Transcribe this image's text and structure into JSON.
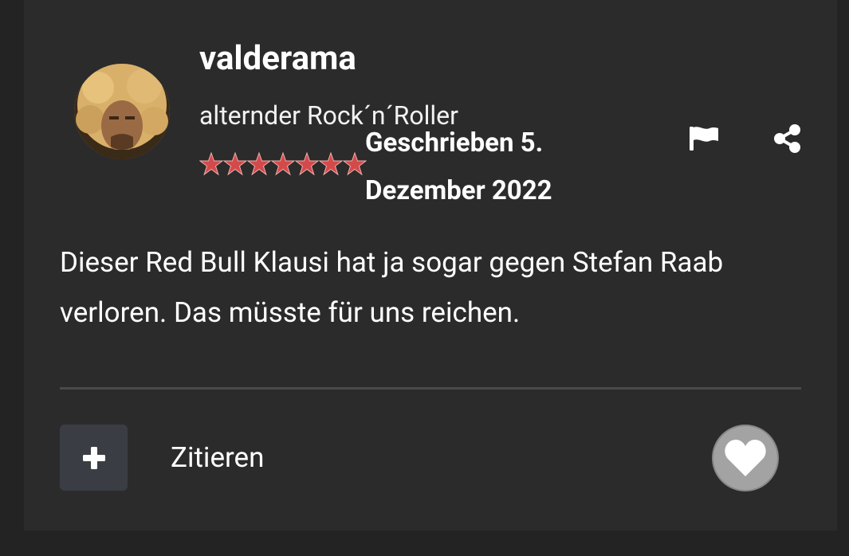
{
  "post": {
    "author": {
      "username": "valderama",
      "user_title": "alternder Rock´n´Roller",
      "rank_stars": 7,
      "avatar_icon": "avatar-photo"
    },
    "date": "Geschrieben 5. Dezember 2022",
    "body": "Dieser Red Bull Klausi hat ja sogar gegen Stefan Raab verloren. Das müsste für uns reichen.",
    "actions": {
      "multiquote_icon": "plus-icon",
      "quote_label": "Zitieren",
      "like_icon": "heart-icon",
      "report_icon": "flag-icon",
      "share_icon": "share-icon"
    }
  },
  "colors": {
    "page_background": "#232323",
    "card_background": "#2b2b2b",
    "text": "#ffffff",
    "divider": "#4a4a4a",
    "multiquote_button": "#3a3e44",
    "like_button": "#a3a3a3",
    "rank_star": "#d44a4a"
  }
}
